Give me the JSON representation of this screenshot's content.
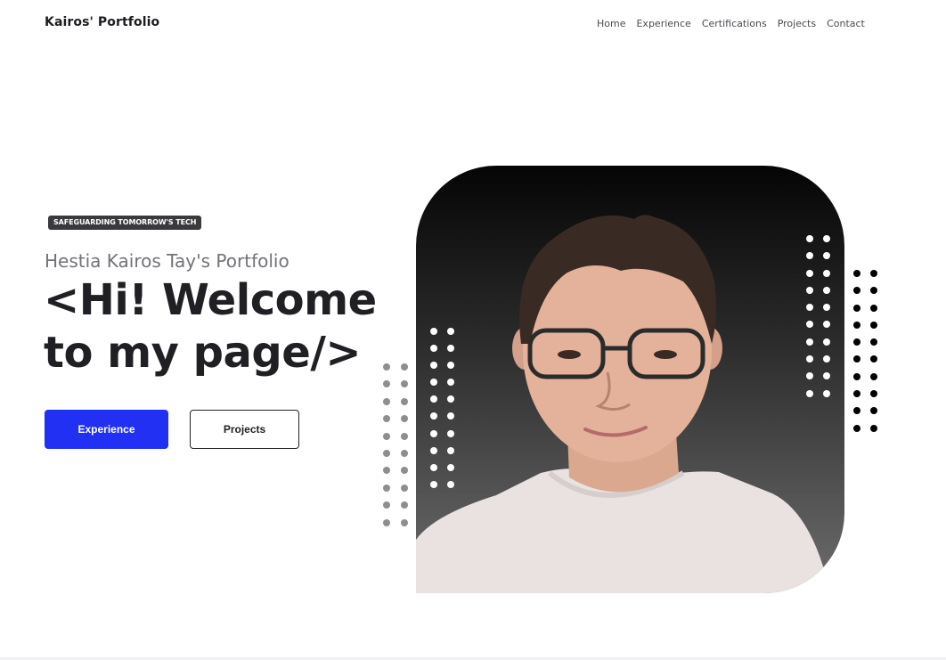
{
  "header": {
    "brand": "Kairos' Portfolio",
    "nav": [
      {
        "label": "Home"
      },
      {
        "label": "Experience"
      },
      {
        "label": "Certifications"
      },
      {
        "label": "Projects"
      },
      {
        "label": "Contact"
      }
    ]
  },
  "hero": {
    "tag": "SAFEGUARDING TOMORROW'S TECH",
    "subtitle": "Hestia Kairos Tay's Portfolio",
    "headline": "<Hi! Welcome to my page/>",
    "buttons": {
      "primary": "Experience",
      "secondary": "Projects"
    }
  },
  "colors": {
    "accent": "#2130f2",
    "text": "#1f1f24",
    "muted": "#72727a",
    "tag_bg": "#3a3a3e"
  }
}
